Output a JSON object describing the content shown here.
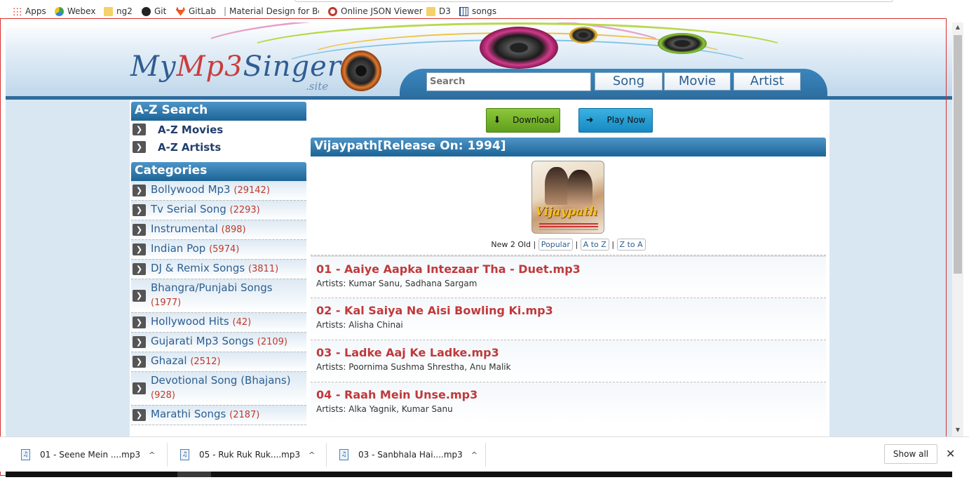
{
  "bookmarks": [
    {
      "label": "Apps",
      "icon": "apps-grid-icon"
    },
    {
      "label": "Webex",
      "icon": "webex-icon"
    },
    {
      "label": "ng2",
      "icon": "folder-icon"
    },
    {
      "label": "Git",
      "icon": "github-icon"
    },
    {
      "label": "GitLab",
      "icon": "gitlab-icon"
    },
    {
      "label": "Material Design for Bo",
      "icon": "page-icon"
    },
    {
      "label": "Online JSON Viewer",
      "icon": "json-viewer-icon"
    },
    {
      "label": "D3",
      "icon": "folder-icon"
    },
    {
      "label": "songs",
      "icon": "grid-page-icon"
    }
  ],
  "site": {
    "logo_my": "My",
    "logo_mp3": "Mp3",
    "logo_singer": "Singer",
    "logo_sub": ".site",
    "search_placeholder": "Search",
    "search_buttons": [
      "Song",
      "Movie",
      "Artist"
    ]
  },
  "sidebar": {
    "az_title": "A-Z Search",
    "az_items": [
      "A-Z Movies",
      "A-Z Artists"
    ],
    "categories_title": "Categories",
    "categories": [
      {
        "name": "Bollywood Mp3",
        "count": "(29142)"
      },
      {
        "name": "Tv Serial Song",
        "count": "(2293)"
      },
      {
        "name": "Instrumental",
        "count": "(898)"
      },
      {
        "name": "Indian Pop",
        "count": "(5974)"
      },
      {
        "name": "DJ & Remix Songs",
        "count": "(3811)"
      },
      {
        "name": "Bhangra/Punjabi Songs",
        "count": "(1977)"
      },
      {
        "name": "Hollywood Hits",
        "count": "(42)"
      },
      {
        "name": "Gujarati Mp3 Songs",
        "count": "(2109)"
      },
      {
        "name": "Ghazal",
        "count": "(2512)"
      },
      {
        "name": "Devotional Song (Bhajans)",
        "count": "(928)"
      },
      {
        "name": "Marathi Songs",
        "count": "(2187)"
      }
    ]
  },
  "main": {
    "download_label": "Download",
    "play_label": "Play Now",
    "album_title": "Vijaypath[Release On: 1994]",
    "cover_title": "Vijaypath",
    "sort_current": "New 2 Old",
    "sort_sep": "|",
    "sort_options": [
      "Popular",
      "A to Z",
      "Z to A"
    ],
    "tracks": [
      {
        "title": "01 - Aaiye Aapka Intezaar Tha - Duet.mp3",
        "artists": "Artists: Kumar Sanu, Sadhana Sargam"
      },
      {
        "title": "02 - Kal Saiya Ne Aisi Bowling Ki.mp3",
        "artists": "Artists: Alisha Chinai"
      },
      {
        "title": "03 - Ladke Aaj Ke Ladke.mp3",
        "artists": "Artists: Poornima Sushma Shrestha, Anu Malik"
      },
      {
        "title": "04 - Raah Mein Unse.mp3",
        "artists": "Artists: Alka Yagnik, Kumar Sanu"
      }
    ]
  },
  "downloads": {
    "items": [
      "01 - Seene Mein ....mp3",
      "05 - Ruk Ruk Ruk....mp3",
      "03 - Sanbhala Hai....mp3"
    ],
    "show_all": "Show all"
  },
  "colors": {
    "header_blue": "#2e6c9c",
    "track_title_red": "#c0393b",
    "link_blue": "#2b5f91",
    "frame_red": "#d9302c"
  }
}
